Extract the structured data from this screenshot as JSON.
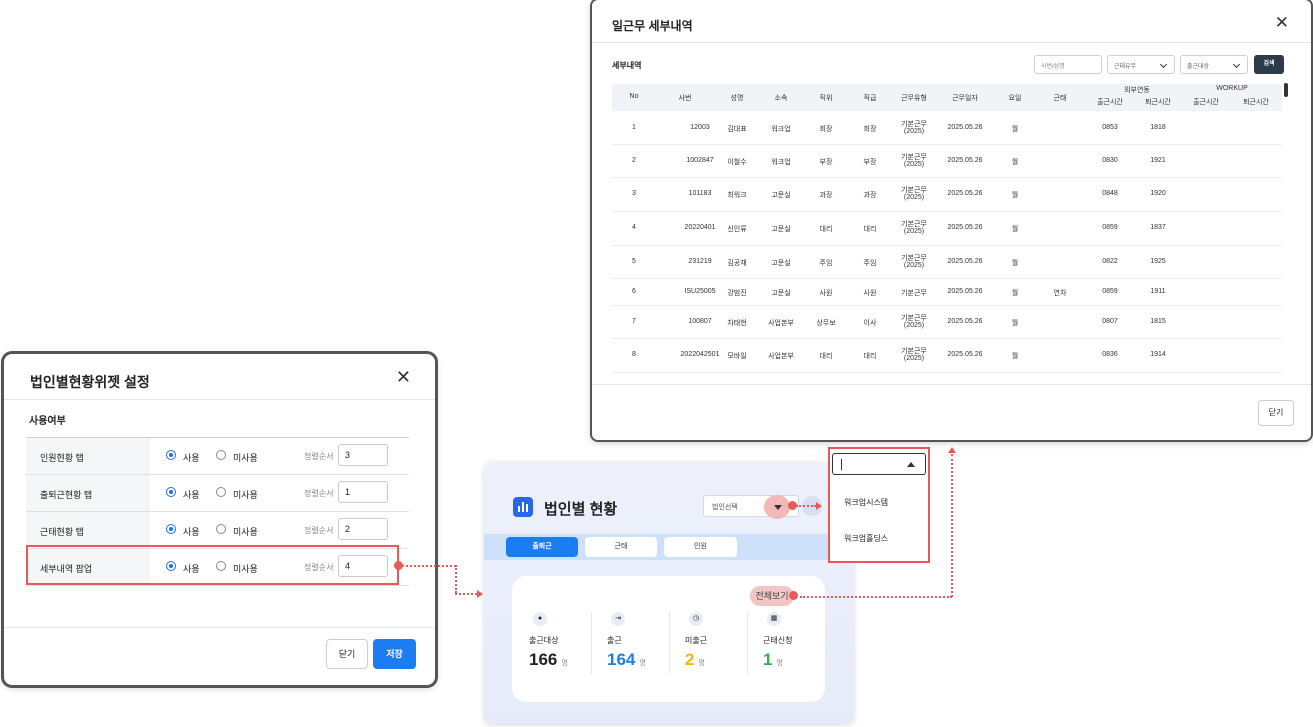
{
  "settings": {
    "title": "법인별현황위젯 설정",
    "section": "사용여부",
    "on_label": "사용",
    "off_label": "미사용",
    "order_label": "정렬순서",
    "rows": [
      {
        "label": "인원현황 탭",
        "order": "3"
      },
      {
        "label": "출퇴근현황 탭",
        "order": "1"
      },
      {
        "label": "근태현황 탭",
        "order": "2"
      },
      {
        "label": "세부내역 팝업",
        "order": "4"
      }
    ],
    "close_label": "닫기",
    "save_label": "저장"
  },
  "widget": {
    "title": "법인별 현황",
    "select_placeholder": "법인선택",
    "tabs": [
      "출퇴근",
      "근태",
      "인원"
    ],
    "view_all": "전체보기",
    "unit": "명",
    "stats": [
      {
        "label": "출근대상",
        "value": "166",
        "color": "#222222"
      },
      {
        "label": "출근",
        "value": "164",
        "color": "#1c7cf2"
      },
      {
        "label": "미출근",
        "value": "2",
        "color": "#f2b705"
      },
      {
        "label": "근태신청",
        "value": "1",
        "color": "#2bb24c"
      }
    ]
  },
  "dropdown": {
    "options": [
      "워크업시스템",
      "워크업홀딩스"
    ]
  },
  "detail": {
    "title": "일근무 세부내역",
    "subtitle": "세부내역",
    "search_placeholder": "사번/성명",
    "filter1": "근태유무",
    "filter2": "출근대상",
    "search_button": "검색",
    "columns": [
      "No",
      "사번",
      "성명",
      "소속",
      "직위",
      "직급",
      "근무유형",
      "근무일자",
      "요일",
      "근태"
    ],
    "group_external": "외부연동",
    "group_workup": "WORKUP",
    "sub_in": "출근시간",
    "sub_out": "퇴근시간",
    "rows": [
      [
        "1",
        "12003",
        "김대표",
        "워크업",
        "회장",
        "회장",
        "기본근무\n(2025)",
        "2025.05.26",
        "월",
        "",
        "0853",
        "1818"
      ],
      [
        "2",
        "1002847",
        "이철수",
        "워크업",
        "부장",
        "부장",
        "기본근무\n(2025)",
        "2025.05.26",
        "월",
        "",
        "0830",
        "1921"
      ],
      [
        "3",
        "101183",
        "최워크",
        "고문실",
        "과장",
        "과장",
        "기본근무\n(2025)",
        "2025.05.26",
        "월",
        "",
        "0848",
        "1920"
      ],
      [
        "4",
        "20220401",
        "신인류",
        "고문실",
        "대리",
        "대리",
        "기본근무\n(2025)",
        "2025.05.26",
        "월",
        "",
        "0859",
        "1837"
      ],
      [
        "5",
        "231219",
        "김공채",
        "고문실",
        "주임",
        "주임",
        "기본근무\n(2025)",
        "2025.05.26",
        "월",
        "",
        "0822",
        "1925"
      ],
      [
        "6",
        "ISU25005",
        "강범진",
        "고문실",
        "사원",
        "사원",
        "기본근무",
        "2025.05.26",
        "월",
        "연차",
        "0859",
        "1911"
      ],
      [
        "7",
        "100807",
        "차태현",
        "사업본부",
        "상무보",
        "이사",
        "기본근무\n(2025)",
        "2025.05.26",
        "월",
        "",
        "0807",
        "1815"
      ],
      [
        "8",
        "2022042501",
        "모바일",
        "사업본부",
        "대리",
        "대리",
        "기본근무\n(2025)",
        "2025.05.26",
        "월",
        "",
        "0836",
        "1914"
      ]
    ],
    "close_label": "닫기"
  }
}
